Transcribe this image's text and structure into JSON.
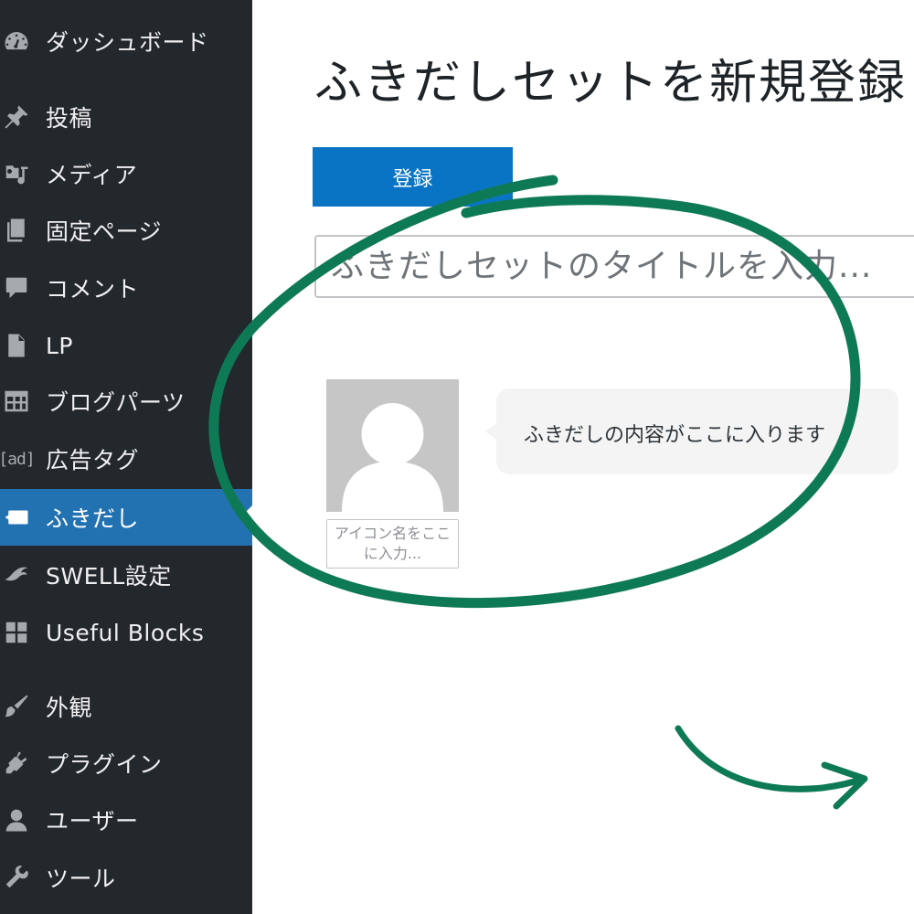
{
  "sidebar": {
    "items": [
      {
        "label": "ダッシュボード",
        "icon": "dashboard-icon"
      },
      {
        "label": "投稿",
        "icon": "pin-icon"
      },
      {
        "label": "メディア",
        "icon": "media-icon"
      },
      {
        "label": "固定ページ",
        "icon": "pages-icon"
      },
      {
        "label": "コメント",
        "icon": "comment-icon"
      },
      {
        "label": "LP",
        "icon": "document-icon"
      },
      {
        "label": "ブログパーツ",
        "icon": "layout-icon"
      },
      {
        "label": "広告タグ",
        "icon": "ad-icon",
        "icon_text": "[ad]"
      },
      {
        "label": "ふきだし",
        "icon": "speech-bubble-icon",
        "active": true
      },
      {
        "label": "SWELL設定",
        "icon": "swell-icon"
      },
      {
        "label": "Useful Blocks",
        "icon": "blocks-icon"
      },
      {
        "label": "外観",
        "icon": "brush-icon"
      },
      {
        "label": "プラグイン",
        "icon": "plugin-icon"
      },
      {
        "label": "ユーザー",
        "icon": "user-icon"
      },
      {
        "label": "ツール",
        "icon": "wrench-icon"
      }
    ],
    "active_color": "#2271b1",
    "background": "#23282d"
  },
  "main": {
    "page_title": "ふきだしセットを新規登録",
    "register_button": "登録",
    "title_input": {
      "placeholder": "ふきだしセットのタイトルを入力...",
      "value": ""
    },
    "avatar_name_placeholder": "アイコン名をここに入力...",
    "bubble_text": "ふきだしの内容がここに入ります",
    "button_color": "#0a74c4"
  },
  "annotation": {
    "color": "#0e7a55",
    "shapes": [
      "circle-annotation",
      "curved-arrow"
    ]
  }
}
